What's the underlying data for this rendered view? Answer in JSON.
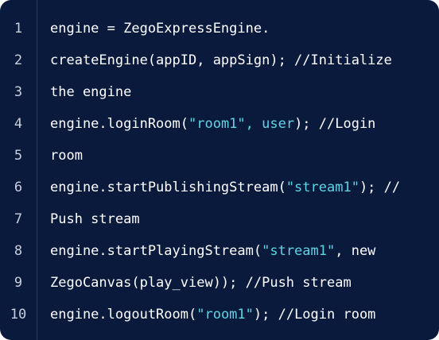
{
  "code_block": {
    "lines": [
      {
        "number": "1",
        "segments": [
          {
            "text": "engine = ZegoExpressEngine.",
            "kind": "plain"
          }
        ]
      },
      {
        "number": "2",
        "segments": [
          {
            "text": "createEngine(appID, appSign); //Initialize",
            "kind": "plain"
          }
        ]
      },
      {
        "number": "3",
        "segments": [
          {
            "text": "the engine",
            "kind": "plain"
          }
        ]
      },
      {
        "number": "4",
        "segments": [
          {
            "text": "engine.loginRoom(",
            "kind": "plain"
          },
          {
            "text": "\"room1\", user",
            "kind": "string"
          },
          {
            "text": "); //Login",
            "kind": "plain"
          }
        ]
      },
      {
        "number": "5",
        "segments": [
          {
            "text": "room",
            "kind": "plain"
          }
        ]
      },
      {
        "number": "6",
        "segments": [
          {
            "text": "engine.startPublishingStream(",
            "kind": "plain"
          },
          {
            "text": "\"stream1\"",
            "kind": "string"
          },
          {
            "text": "); //",
            "kind": "plain"
          }
        ]
      },
      {
        "number": "7",
        "segments": [
          {
            "text": "Push stream",
            "kind": "plain"
          }
        ]
      },
      {
        "number": "8",
        "segments": [
          {
            "text": "engine.startPlayingStream(",
            "kind": "plain"
          },
          {
            "text": "\"stream1\"",
            "kind": "string"
          },
          {
            "text": ", new",
            "kind": "plain"
          }
        ]
      },
      {
        "number": "9",
        "segments": [
          {
            "text": "ZegoCanvas(play_view)); //Push stream",
            "kind": "plain"
          }
        ]
      },
      {
        "number": "10",
        "segments": [
          {
            "text": "engine.logoutRoom(",
            "kind": "plain"
          },
          {
            "text": "\"room1\"",
            "kind": "string"
          },
          {
            "text": "); //Login room",
            "kind": "plain"
          }
        ]
      }
    ]
  },
  "colors": {
    "background": "#0a1a3c",
    "text": "#ffffff",
    "line_number": "#c8cfdc",
    "string": "#5fd4e6",
    "divider": "#2a3a5c"
  }
}
